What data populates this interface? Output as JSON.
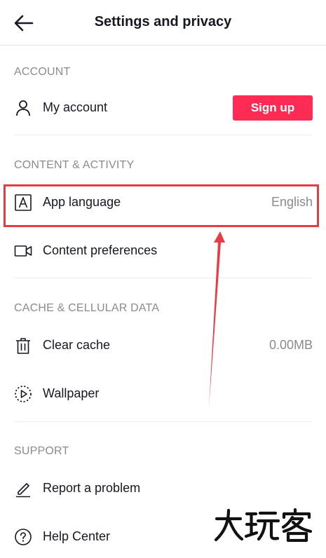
{
  "header": {
    "title": "Settings and privacy",
    "back_icon": "arrow-left-icon"
  },
  "sections": {
    "account": {
      "title": "ACCOUNT",
      "my_account": {
        "label": "My account",
        "icon": "person-icon",
        "button": "Sign up"
      }
    },
    "content_activity": {
      "title": "CONTENT & ACTIVITY",
      "app_language": {
        "label": "App language",
        "value": "English",
        "icon": "language-a-icon"
      },
      "content_preferences": {
        "label": "Content preferences",
        "icon": "video-camera-icon"
      }
    },
    "cache": {
      "title": "CACHE & CELLULAR DATA",
      "clear_cache": {
        "label": "Clear cache",
        "value": "0.00MB",
        "icon": "trash-icon"
      },
      "wallpaper": {
        "label": "Wallpaper",
        "icon": "play-circle-icon"
      }
    },
    "support": {
      "title": "SUPPORT",
      "report": {
        "label": "Report a problem",
        "icon": "pencil-icon"
      },
      "help": {
        "label": "Help Center",
        "icon": "question-circle-icon"
      }
    }
  },
  "annotation": {
    "highlight_color": "#e63c44"
  },
  "watermark": {
    "text": "大玩客"
  },
  "colors": {
    "accent": "#fe2c55",
    "text": "#161823",
    "muted": "#8a8b91"
  }
}
